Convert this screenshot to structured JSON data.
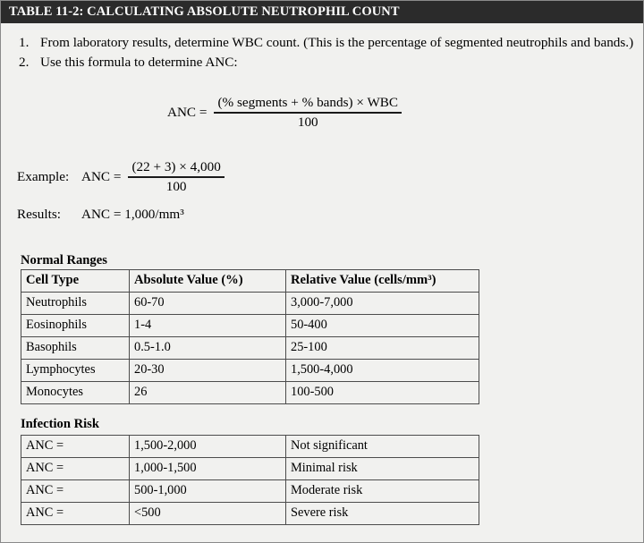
{
  "header": {
    "title": "TABLE 11-2: CALCULATING ABSOLUTE NEUTROPHIL COUNT",
    "bar_color": "#2b2b2b",
    "text_color": "#ffffff"
  },
  "page": {
    "background_color": "#f1f1ef",
    "border_color": "#8a8a8a"
  },
  "steps": [
    {
      "number": "1.",
      "text": "From laboratory results, determine WBC count. (This is the percentage of segmented neutrophils and bands.)"
    },
    {
      "number": "2.",
      "text": "Use this formula to determine ANC:"
    }
  ],
  "formula": {
    "lhs": "ANC =",
    "numerator": "(% segments + % bands) × WBC",
    "denominator": "100"
  },
  "example": {
    "label": "Example:",
    "lhs": "ANC =",
    "numerator": "(22 + 3) × 4,000",
    "denominator": "100"
  },
  "results": {
    "label": "Results:",
    "value": "ANC = 1,000/mm³"
  },
  "normal_ranges": {
    "caption": "Normal Ranges",
    "columns": [
      "Cell Type",
      "Absolute Value (%)",
      "Relative Value (cells/mm³)"
    ],
    "rows": [
      [
        "Neutrophils",
        "60-70",
        "3,000-7,000"
      ],
      [
        "Eosinophils",
        "1-4",
        "50-400"
      ],
      [
        "Basophils",
        "0.5-1.0",
        "25-100"
      ],
      [
        "Lymphocytes",
        "20-30",
        "1,500-4,000"
      ],
      [
        "Monocytes",
        "26",
        "100-500"
      ]
    ]
  },
  "infection_risk": {
    "caption": "Infection Risk",
    "rows": [
      [
        "ANC =",
        "1,500-2,000",
        "Not significant"
      ],
      [
        "ANC =",
        "1,000-1,500",
        "Minimal risk"
      ],
      [
        "ANC =",
        "500-1,000",
        "Moderate risk"
      ],
      [
        "ANC =",
        "<500",
        "Severe risk"
      ]
    ]
  }
}
